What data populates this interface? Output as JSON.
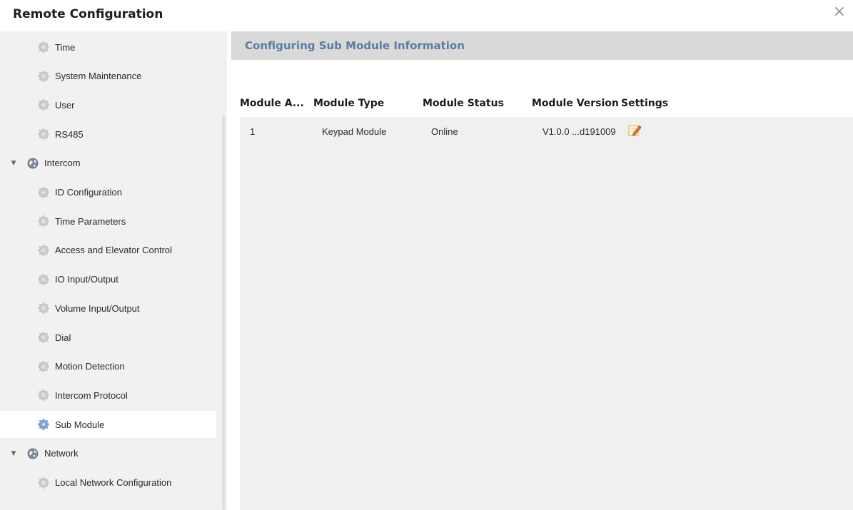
{
  "window": {
    "title": "Remote Configuration",
    "close_label": "×"
  },
  "sidebar": {
    "items": [
      {
        "label": "Time",
        "kind": "leaf",
        "icon": "gear-icon"
      },
      {
        "label": "System Maintenance",
        "kind": "leaf",
        "icon": "gear-icon"
      },
      {
        "label": "User",
        "kind": "leaf",
        "icon": "gear-icon"
      },
      {
        "label": "RS485",
        "kind": "leaf",
        "icon": "gear-icon"
      },
      {
        "label": "Intercom",
        "kind": "group",
        "icon": "globe-icon",
        "expanded": true
      },
      {
        "label": "ID Configuration",
        "kind": "leaf",
        "icon": "gear-icon"
      },
      {
        "label": "Time Parameters",
        "kind": "leaf",
        "icon": "gear-icon"
      },
      {
        "label": "Access and Elevator Control",
        "kind": "leaf",
        "icon": "gear-icon"
      },
      {
        "label": "IO Input/Output",
        "kind": "leaf",
        "icon": "gear-icon"
      },
      {
        "label": "Volume Input/Output",
        "kind": "leaf",
        "icon": "gear-icon"
      },
      {
        "label": "Dial",
        "kind": "leaf",
        "icon": "gear-icon"
      },
      {
        "label": "Motion Detection",
        "kind": "leaf",
        "icon": "gear-icon"
      },
      {
        "label": "Intercom Protocol",
        "kind": "leaf",
        "icon": "gear-icon"
      },
      {
        "label": "Sub Module",
        "kind": "leaf",
        "icon": "gear-icon",
        "selected": true
      },
      {
        "label": "Network",
        "kind": "group",
        "icon": "globe-icon",
        "expanded": true
      },
      {
        "label": "Local Network Configuration",
        "kind": "leaf",
        "icon": "gear-icon"
      }
    ],
    "expander_glyph": "▼"
  },
  "panel": {
    "title": "Configuring Sub Module Information",
    "columns": [
      "Module A...",
      "Module Type",
      "Module Status",
      "Module Version",
      "Settings"
    ],
    "rows": [
      {
        "address": "1",
        "type": "Keypad Module",
        "status": "Online",
        "version": "V1.0.0 ...d191009",
        "settings_icon": "edit-icon"
      }
    ]
  },
  "colors": {
    "accent_title": "#5b7ca3",
    "panel_header_bg": "#d9d9d9",
    "sidebar_bg": "#f1f1f1",
    "selected_bg": "#ffffff"
  }
}
